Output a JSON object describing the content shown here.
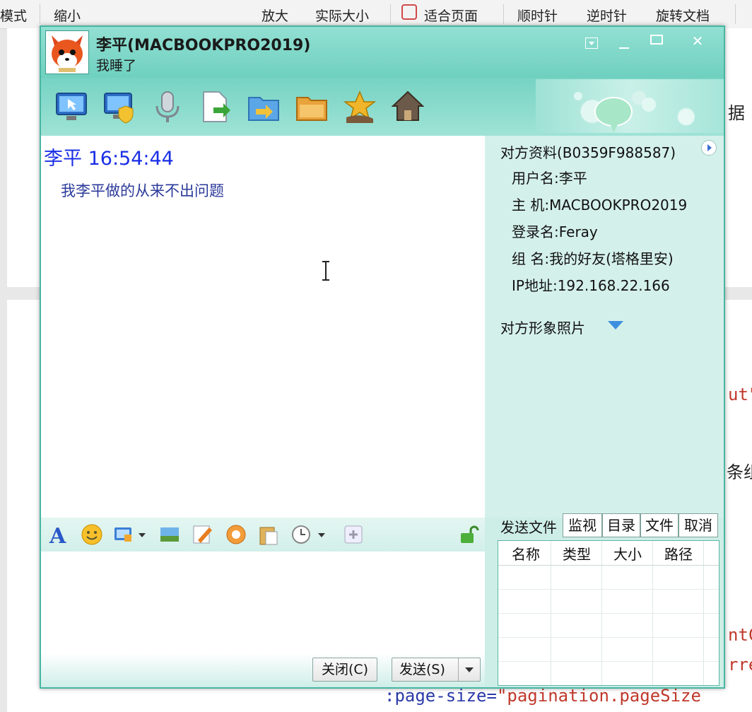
{
  "background_app": {
    "toolbar": [
      "模式",
      "缩小",
      "放大",
      "实际大小",
      "适合页面",
      "顺时针",
      "逆时针",
      "旋转文档"
    ],
    "fragments": {
      "right_top": "据",
      "right_mid": "ut\"",
      "right_mid2": "条组",
      "right_code1": "ntC",
      "right_code2": "rre"
    },
    "code_line": {
      "prefix": ":page-size=",
      "value": "\"pagination.pageSize"
    }
  },
  "chat_window": {
    "title": "李平(MACBOOKPRO2019)",
    "status": "我睡了",
    "window_buttons": [
      "menu",
      "minimize",
      "maximize",
      "close"
    ],
    "toolbar_icons": [
      "remote-assist-icon",
      "remote-control-icon",
      "voice-chat-icon",
      "send-file-icon",
      "send-folder-icon",
      "shared-folder-icon",
      "favorite-icon",
      "home-icon"
    ],
    "messages": [
      {
        "sender": "李平",
        "time": "16:54:44",
        "text": "我李平做的从来不出问题"
      }
    ],
    "format_icons": [
      "font-icon",
      "emoji-icon",
      "screenshot-icon",
      "image-icon",
      "handwriting-icon",
      "shake-icon",
      "paste-icon",
      "history-icon",
      "plugin-icon",
      "lock-icon"
    ],
    "buttons": {
      "close": "关闭(C)",
      "send": "发送(S)"
    },
    "info": {
      "header": "对方资料(B0359F988587)",
      "username": "用户名:李平",
      "host": "主  机:MACBOOKPRO2019",
      "login": "登录名:Feray",
      "group": "组  名:我的好友(塔格里安)",
      "ip": "IP地址:192.168.22.166",
      "photo_label": "对方形象照片"
    },
    "file_panel": {
      "label": "发送文件",
      "tabs": [
        "监视",
        "目录",
        "文件",
        "取消"
      ],
      "columns": [
        "名称",
        "类型",
        "大小",
        "路径"
      ]
    }
  }
}
